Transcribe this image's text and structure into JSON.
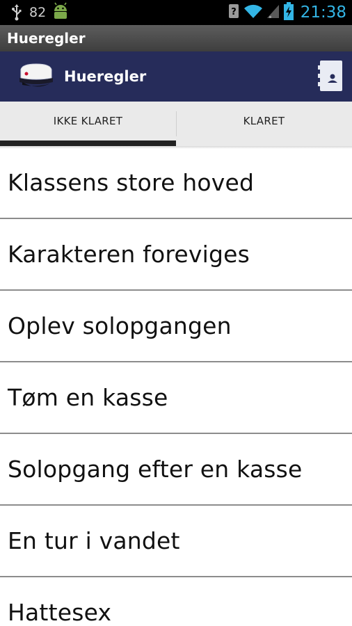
{
  "status_bar": {
    "battery_percent": "82",
    "clock": "21:38",
    "icons": [
      "usb-icon",
      "android-debug-icon",
      "signal-unknown-icon",
      "wifi-icon",
      "cell-signal-icon",
      "battery-charging-icon"
    ]
  },
  "window": {
    "title": "Hueregler"
  },
  "action_bar": {
    "title": "Hueregler",
    "logo_icon": "student-cap-icon",
    "action_icon": "contact-card-icon",
    "background": "#262c5a"
  },
  "tabs": [
    {
      "label": "IKKE KLARET",
      "active": true
    },
    {
      "label": "KLARET",
      "active": false
    }
  ],
  "rules": [
    {
      "label": "Klassens store hoved"
    },
    {
      "label": "Karakteren foreviges"
    },
    {
      "label": "Oplev solopgangen"
    },
    {
      "label": "Tøm en kasse"
    },
    {
      "label": "Solopgang efter en kasse"
    },
    {
      "label": "En tur i vandet"
    },
    {
      "label": "Hattesex"
    }
  ],
  "colors": {
    "accent": "#33b5e5",
    "action_bar": "#262c5a",
    "tab_indicator": "#222222"
  }
}
